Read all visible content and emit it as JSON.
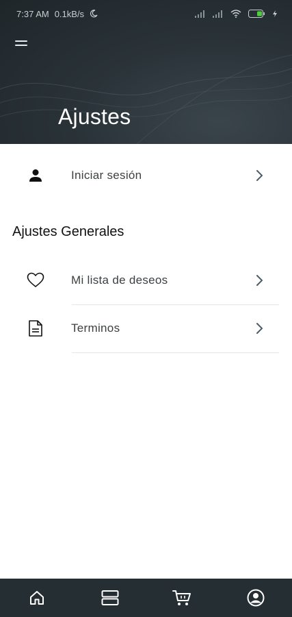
{
  "status_bar": {
    "time": "7:37 AM",
    "speed": "0.1kB/s",
    "battery_color": "#4cd137"
  },
  "header": {
    "title": "Ajustes",
    "menu_icon": "hamburger-menu-icon"
  },
  "account": {
    "login_label": "Iniciar sesión",
    "login_icon": "person-icon"
  },
  "general": {
    "section_title": "Ajustes Generales",
    "items": [
      {
        "label": "Mi lista de deseos",
        "icon": "heart-icon"
      },
      {
        "label": "Terminos",
        "icon": "document-icon"
      }
    ]
  },
  "bottom_nav": {
    "items": [
      "home-icon",
      "list-icon",
      "cart-icon",
      "account-icon"
    ],
    "background": "#252e33"
  },
  "colors": {
    "header_bg": "#232c31",
    "text": "#3b3f42",
    "chevron": "#4a5a66"
  }
}
